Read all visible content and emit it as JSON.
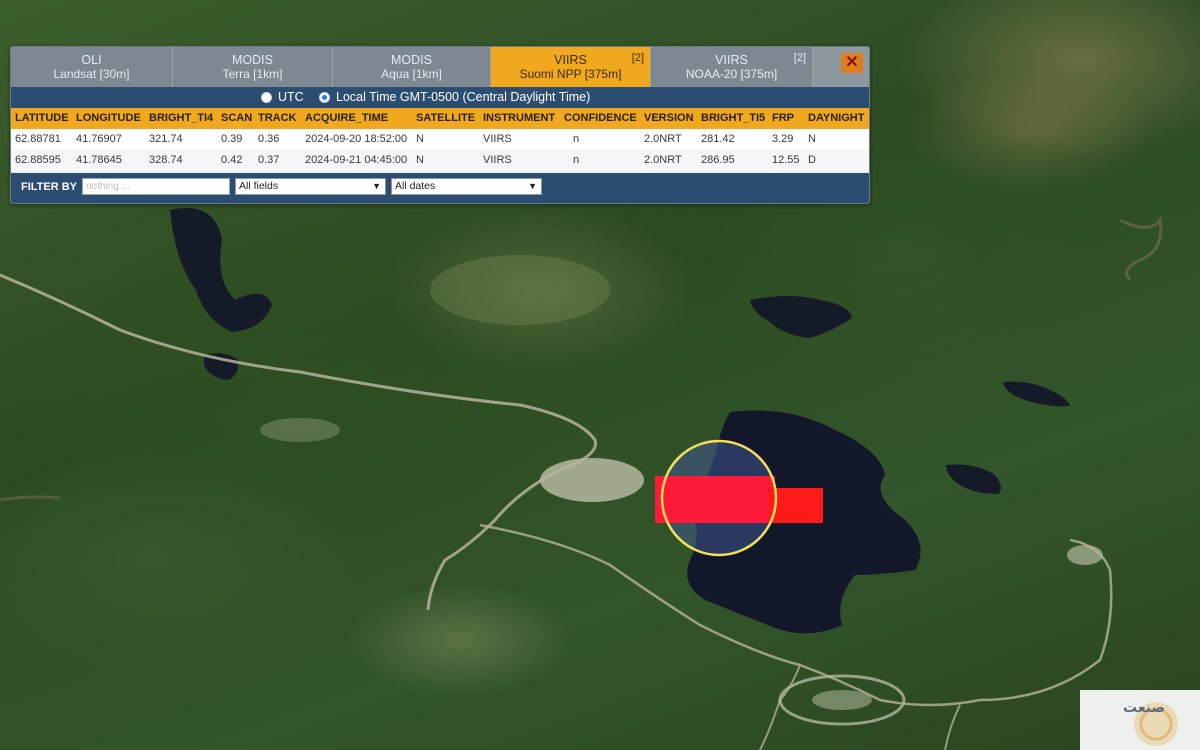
{
  "tabs": [
    {
      "name": "OLI",
      "sub": "Landsat [30m]",
      "count": ""
    },
    {
      "name": "MODIS",
      "sub": "Terra [1km]",
      "count": ""
    },
    {
      "name": "MODIS",
      "sub": "Aqua [1km]",
      "count": ""
    },
    {
      "name": "VIIRS",
      "sub": "Suomi NPP [375m]",
      "count": "[2]"
    },
    {
      "name": "VIIRS",
      "sub": "NOAA-20 [375m]",
      "count": "[2]"
    }
  ],
  "active_tab": "VIIRS Suomi NPP [375m]",
  "close_icon": "✕",
  "time": {
    "utc_label": "UTC",
    "local_label": "Local Time GMT-0500 (Central Daylight Time)",
    "selected": "local"
  },
  "table": {
    "columns": [
      "LATITUDE",
      "LONGITUDE",
      "BRIGHT_TI4",
      "SCAN",
      "TRACK",
      "ACQUIRE_TIME",
      "SATELLITE",
      "INSTRUMENT",
      "CONFIDENCE",
      "VERSION",
      "BRIGHT_TI5",
      "FRP",
      "DAYNIGHT"
    ],
    "rows": [
      [
        "62.88781",
        "41.76907",
        "321.74",
        "0.39",
        "0.36",
        "2024-09-20 18:52:00",
        "N",
        "VIIRS",
        "n",
        "2.0NRT",
        "281.42",
        "3.29",
        "N"
      ],
      [
        "62.88595",
        "41.78645",
        "328.74",
        "0.42",
        "0.37",
        "2024-09-21 04:45:00",
        "N",
        "VIIRS",
        "n",
        "2.0NRT",
        "286.95",
        "12.55",
        "D"
      ]
    ]
  },
  "filter": {
    "label": "FILTER BY",
    "placeholder": "nothing ...",
    "field_select": "All fields",
    "date_select": "All dates"
  },
  "colors": {
    "accent": "#f0a81e",
    "header_bar": "#2c4d72",
    "fire_marker": "#ff1a3a",
    "highlight_circle": "#f2e05a"
  },
  "icons": {
    "close": "close-icon",
    "select_arrow": "chevron-down-icon"
  },
  "watermark": {
    "text": "صنعت"
  }
}
